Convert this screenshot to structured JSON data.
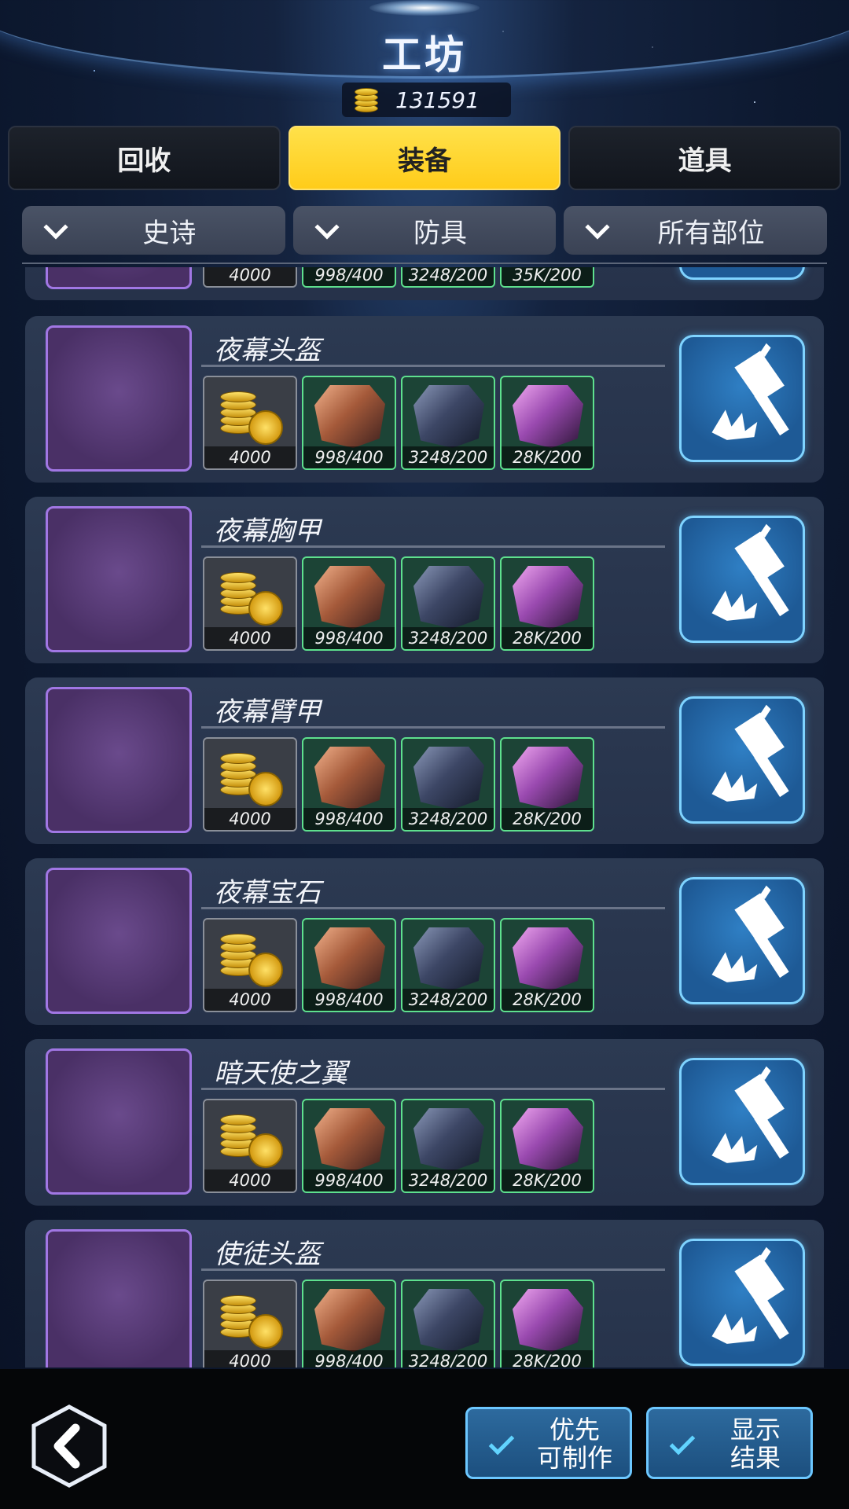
{
  "header": {
    "title": "工坊",
    "coins": "131591"
  },
  "tabs": [
    {
      "label": "回收",
      "active": false
    },
    {
      "label": "装备",
      "active": true
    },
    {
      "label": "道具",
      "active": false
    }
  ],
  "filters": [
    {
      "label": "史诗"
    },
    {
      "label": "防具"
    },
    {
      "label": "所有部位"
    }
  ],
  "partial_row": {
    "materials": [
      "4000",
      "998/400",
      "3248/200",
      "35K/200"
    ]
  },
  "items": [
    {
      "name": "夜幕头盔",
      "icon": "helmet-icon",
      "materials": [
        "4000",
        "998/400",
        "3248/200",
        "28K/200"
      ]
    },
    {
      "name": "夜幕胸甲",
      "icon": "chest-armor-icon",
      "materials": [
        "4000",
        "998/400",
        "3248/200",
        "28K/200"
      ]
    },
    {
      "name": "夜幕臂甲",
      "icon": "arm-armor-icon",
      "materials": [
        "4000",
        "998/400",
        "3248/200",
        "28K/200"
      ]
    },
    {
      "name": "夜幕宝石",
      "icon": "gem-icon",
      "materials": [
        "4000",
        "998/400",
        "3248/200",
        "28K/200"
      ]
    },
    {
      "name": "暗天使之翼",
      "icon": "wing-icon",
      "materials": [
        "4000",
        "998/400",
        "3248/200",
        "28K/200"
      ]
    },
    {
      "name": "使徒头盔",
      "icon": "apostle-helmet-icon",
      "materials": [
        "4000",
        "998/400",
        "3248/200",
        "28K/200"
      ]
    }
  ],
  "bottom": {
    "priority_label_1": "优先",
    "priority_label_2": "可制作",
    "show_label_1": "显示",
    "show_label_2": "结果"
  }
}
